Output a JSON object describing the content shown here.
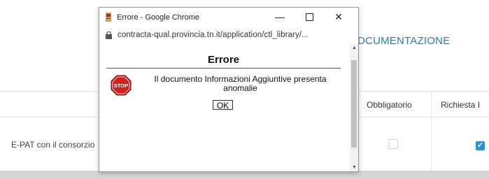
{
  "background": {
    "heading": "DCUMENTAZIONE",
    "columns": {
      "obbligatorio": "Obbligatorio",
      "richiesta": "Richiesta I"
    },
    "row_text": "E-PAT con il consorzio"
  },
  "popup": {
    "window_title": "Errore - Google Chrome",
    "url": "contracta-qual.provincia.tn.it/application/ctl_library/...",
    "controls": {
      "minimize": "—",
      "close": "✕"
    },
    "dialog": {
      "title": "Errore",
      "message_line1": "Il documento Informazioni Aggiuntive presenta",
      "message_line2": "anomalie",
      "ok_label": "OK",
      "stop_text": "STOP"
    }
  },
  "colors": {
    "heading": "#2a7fa8",
    "checkbox_checked": "#2f8fd8",
    "stop_red": "#d0201c"
  }
}
